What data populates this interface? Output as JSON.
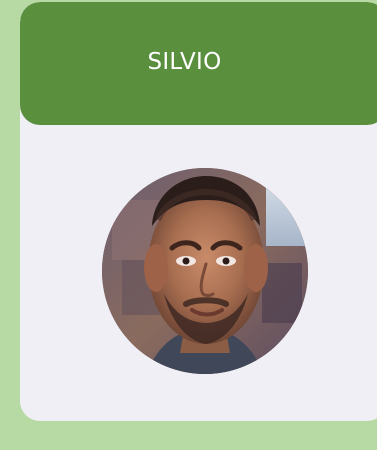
{
  "profile_card": {
    "name": "SILVIO",
    "avatar_icon": "person-photo-avatar"
  },
  "colors": {
    "page_background": "#b7d9a4",
    "header_background": "#5a8f3e",
    "card_background": "#f1eff6",
    "title_text": "#ffffff"
  }
}
